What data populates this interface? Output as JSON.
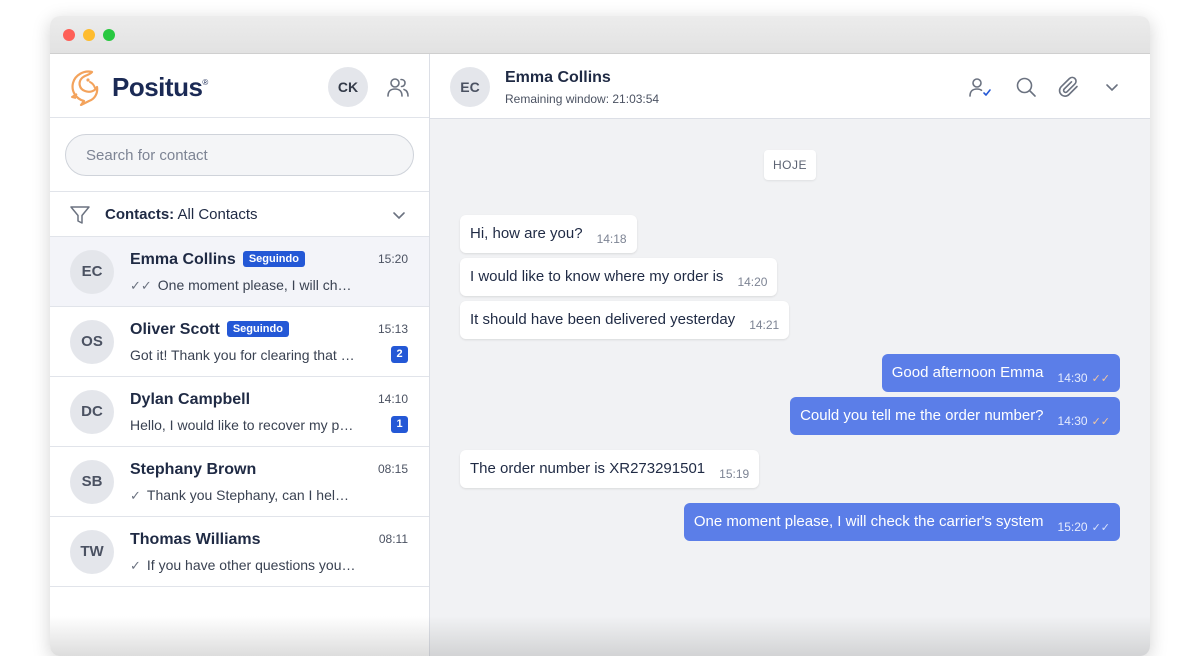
{
  "app": {
    "name": "Positus"
  },
  "me": {
    "initials": "CK"
  },
  "search": {
    "placeholder": "Search for contact"
  },
  "filter": {
    "label": "Contacts:",
    "value": "All Contacts"
  },
  "contacts": [
    {
      "initials": "EC",
      "name": "Emma Collins",
      "badge": "Seguindo",
      "time": "15:20",
      "tick": "✓✓",
      "preview": "One moment please, I will check the carrier's system",
      "unread": ""
    },
    {
      "initials": "OS",
      "name": "Oliver Scott",
      "badge": "Seguindo",
      "time": "15:13",
      "tick": "",
      "preview": "Got it! Thank you for clearing that up",
      "unread": "2"
    },
    {
      "initials": "DC",
      "name": "Dylan Campbell",
      "badge": "",
      "time": "14:10",
      "tick": "",
      "preview": "Hello, I would like to recover my password",
      "unread": "1"
    },
    {
      "initials": "SB",
      "name": "Stephany Brown",
      "badge": "",
      "time": "08:15",
      "tick": "✓",
      "preview": "Thank you Stephany, can I help with anything else?",
      "unread": ""
    },
    {
      "initials": "TW",
      "name": "Thomas Williams",
      "badge": "",
      "time": "08:11",
      "tick": "✓",
      "preview": "If you have other questions you can contact us",
      "unread": ""
    }
  ],
  "chat": {
    "initials": "EC",
    "name": "Emma Collins",
    "window_label": "Remaining window: 21:03:54",
    "day": "HOJE",
    "messages": [
      {
        "dir": "in",
        "text": "Hi, how are you?",
        "time": "14:18"
      },
      {
        "dir": "in",
        "text": "I would like to know where my order is",
        "time": "14:20"
      },
      {
        "dir": "in",
        "text": "It should have been delivered yesterday",
        "time": "14:21"
      },
      {
        "dir": "out",
        "text": "Good afternoon Emma",
        "time": "14:30",
        "ticks": "✓✓"
      },
      {
        "dir": "out",
        "text": "Could you tell me the order number?",
        "time": "14:30",
        "ticks": "✓✓"
      },
      {
        "dir": "in",
        "text": "The order number is XR273291501",
        "time": "15:19"
      },
      {
        "dir": "out",
        "text": "One moment please, I will check the carrier's system",
        "time": "15:20",
        "ticks": "✓✓"
      }
    ]
  },
  "colors": {
    "accent": "#2458d6",
    "outgoing_bubble": "#5b7ee8",
    "logo": "#f3a35c",
    "chat_bg": "#f1f2f4"
  }
}
